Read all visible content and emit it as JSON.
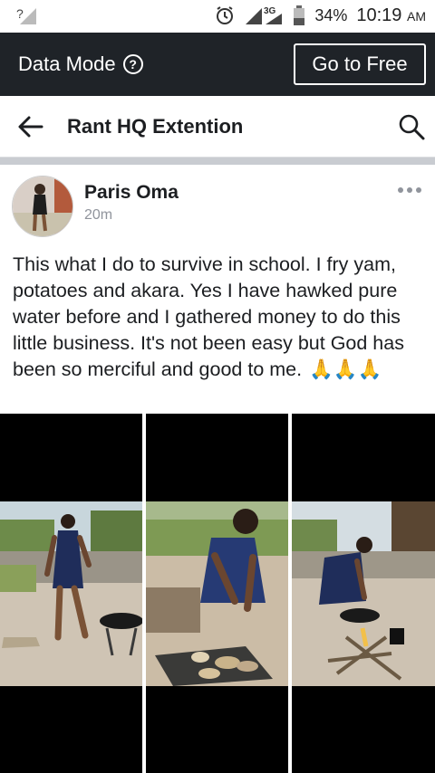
{
  "status_bar": {
    "sim_indicator": "?",
    "network": "3G",
    "battery": "34%",
    "time": "10:19",
    "ampm": "AM",
    "icons": [
      "signal-unknown-icon",
      "alarm-icon",
      "signal-icon",
      "battery-icon"
    ]
  },
  "data_mode": {
    "label": "Data Mode",
    "info_glyph": "?",
    "go_free": "Go to Free"
  },
  "header": {
    "title": "Rant HQ Extention",
    "icons": [
      "back-arrow-icon",
      "search-icon"
    ]
  },
  "post": {
    "author": "Paris Oma",
    "time": "20m",
    "text": "This what I do to survive in school. I fry yam, potatoes and akara. Yes I have hawked pure water before and I gathered money to do this little business. It's not been easy but God has been so merciful and good to me.",
    "emoji": "🙏🙏🙏",
    "photos": [
      "photo-woman-standing",
      "photo-woman-peeling-yam",
      "photo-woman-frying"
    ]
  },
  "colors": {
    "data_bar": "#1f2328",
    "divider": "#c9ccd1",
    "meta_text": "#90949c"
  }
}
